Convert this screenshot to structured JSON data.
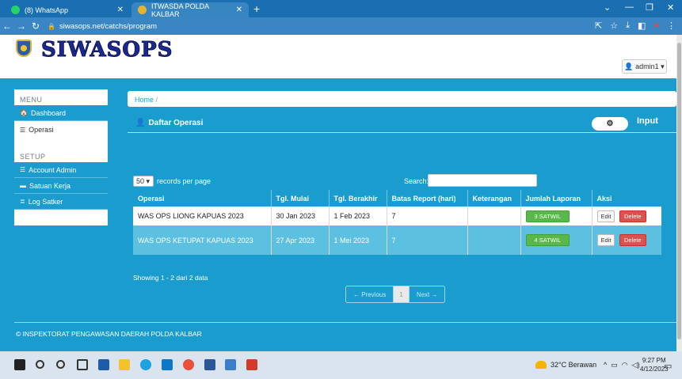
{
  "browser": {
    "tabs": [
      {
        "label": "(8) WhatsApp",
        "favicon_color": "#25d366"
      },
      {
        "label": "ITWASDA POLDA KALBAR",
        "favicon_color": "#e8b331"
      }
    ],
    "url": "siwasops.net/catchs/program"
  },
  "header": {
    "brand": "SIWASOPS",
    "user_menu": "admin1"
  },
  "sidebar": {
    "menu_heading": "MENU",
    "menu_items": [
      {
        "label": "Dashboard",
        "icon": "home-icon"
      },
      {
        "label": "Operasi",
        "icon": "list-icon",
        "active": true
      }
    ],
    "setup_heading": "SETUP",
    "setup_items": [
      {
        "label": "Account Admin",
        "icon": "list-icon"
      },
      {
        "label": "Satuan Kerja",
        "icon": "comment-icon"
      },
      {
        "label": "Log Satker",
        "icon": "align-icon"
      }
    ]
  },
  "breadcrumb": {
    "home": "Home",
    "separator": "/"
  },
  "panel": {
    "title": "Daftar Operasi",
    "action_label": "Input"
  },
  "table_controls": {
    "page_size": "50",
    "page_size_suffix": "records per page",
    "search_label": "Search:",
    "search_value": ""
  },
  "table": {
    "headers": [
      "Operasi",
      "Tgl. Mulai",
      "Tgl. Berakhir",
      "Batas Report (hari)",
      "Keterangan",
      "Jumlah Laporan",
      "Aksi"
    ],
    "rows": [
      {
        "operasi": "WAS OPS LIONG KAPUAS 2023",
        "mulai": "30 Jan 2023",
        "berakhir": "1 Feb 2023",
        "batas": "7",
        "keterangan": "",
        "laporan": "3  SATWIL",
        "edit": "Edit",
        "delete": "Delete"
      },
      {
        "operasi": "WAS OPS KETUPAT KAPUAS 2023",
        "mulai": "27 Apr 2023",
        "berakhir": "1 Mei 2023",
        "batas": "7",
        "keterangan": "",
        "laporan": "4  SATWIL",
        "edit": "Edit",
        "delete": "Delete"
      }
    ]
  },
  "showing": "Showing 1 - 2 dari 2 data",
  "pagination": {
    "previous": "← Previous",
    "current": "1",
    "next": "Next →"
  },
  "footer": "© INSPEKTORAT PENGAWASAN DAERAH POLDA KALBAR",
  "taskbar": {
    "weather": "32°C  Berawan",
    "time": "9:27 PM",
    "date": "4/12/2023"
  },
  "colors": {
    "primary": "#1a9ccf",
    "success": "#58b84a",
    "danger": "#d9534f",
    "brand": "#1b2a8c"
  }
}
